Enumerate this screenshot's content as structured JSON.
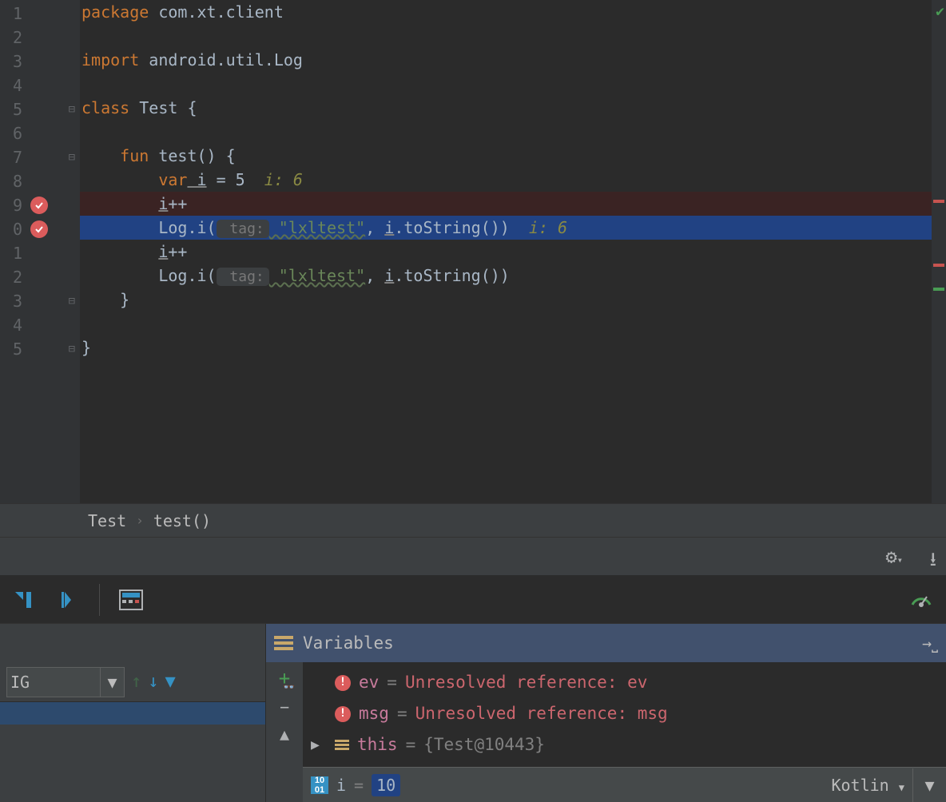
{
  "gutter": {
    "lines": [
      "1",
      "2",
      "3",
      "4",
      "5",
      "6",
      "7",
      "8",
      "9",
      "0",
      "1",
      "2",
      "3",
      "4",
      "5"
    ]
  },
  "code": {
    "line1": {
      "kw": "package",
      "rest": " com.xt.client"
    },
    "line3": {
      "kw": "import",
      "rest": " android.util.Log"
    },
    "line5": {
      "kw": "class",
      "name": " Test ",
      "brace": "{"
    },
    "line7": {
      "kw": "fun",
      "name": " test",
      "rest": "() {"
    },
    "line8": {
      "kw": "var",
      "i": " i",
      "rest": " = 5",
      "hint": "  i: 6"
    },
    "line9": {
      "i": "i",
      "rest": "++"
    },
    "line10": {
      "log": "Log.i(",
      "tag": " tag:",
      "str": " \"lxltest\"",
      "comma": ", ",
      "i": "i",
      "rest": ".toString())",
      "hint": "  i: 6"
    },
    "line11": {
      "i": "i",
      "rest": "++"
    },
    "line12": {
      "log": "Log.i(",
      "tag": " tag:",
      "str": " \"lxltest\"",
      "comma": ", ",
      "i": "i",
      "rest": ".toString())"
    },
    "line13": {
      "brace": "}"
    },
    "line15": {
      "brace": "}"
    }
  },
  "breadcrumb": {
    "class": "Test",
    "method": "test()"
  },
  "filter": {
    "label": "IG"
  },
  "variables": {
    "title": "Variables",
    "rows": [
      {
        "name": "ev",
        "eq": " = ",
        "err": "Unresolved reference: ev"
      },
      {
        "name": "msg",
        "eq": " = ",
        "err": "Unresolved reference: msg"
      }
    ],
    "thisrow": {
      "name": "this",
      "eq": " = ",
      "val": "{Test@10443}"
    },
    "input": {
      "name": "i",
      "eq": " = ",
      "val": "10",
      "lang": "Kotlin"
    }
  }
}
